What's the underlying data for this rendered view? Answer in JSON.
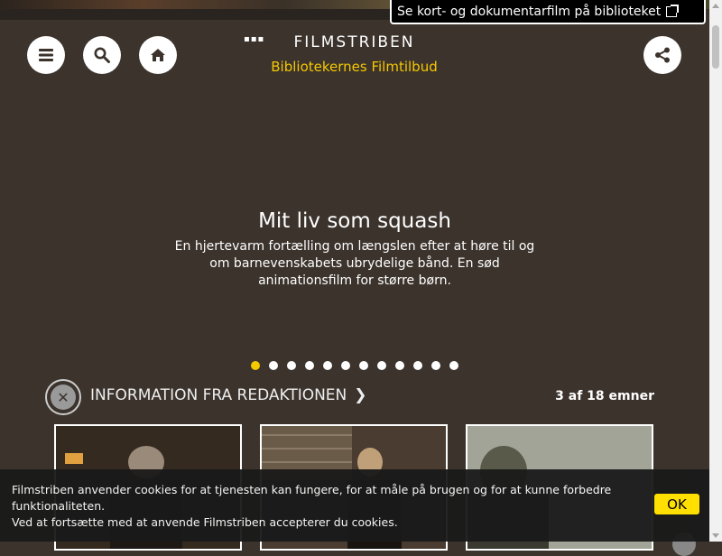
{
  "top_link": {
    "label": "Se kort- og dokumentarfilm på biblioteket"
  },
  "header": {
    "logo_text": "FILMSTRIBEN",
    "subtitle": "Bibliotekernes Filmtilbud",
    "buttons": [
      "menu-icon",
      "search-icon",
      "home-icon",
      "share-icon"
    ]
  },
  "hero": {
    "title": "Mit liv som squash",
    "description": "En hjertevarm fortælling om længslen efter at høre til og om barnevenskabets ubrydelige bånd. En sød animationsfilm for større børn.",
    "slide_count": 12,
    "active_slide": 1
  },
  "section": {
    "title": "INFORMATION FRA REDAKTIONEN",
    "count": "3 af 18 emner"
  },
  "cookie": {
    "text_line1": "Filmstriben anvender cookies for at tjenesten kan fungere, for at måle på brugen og for at kunne forbedre funktionaliteten.",
    "text_line2": "Ved at fortsætte med at anvende Filmstriben accepterer du cookies.",
    "ok_label": "OK"
  },
  "colors": {
    "accent": "#f6c800",
    "background": "#3b332c",
    "ok_button": "#ffe000"
  }
}
